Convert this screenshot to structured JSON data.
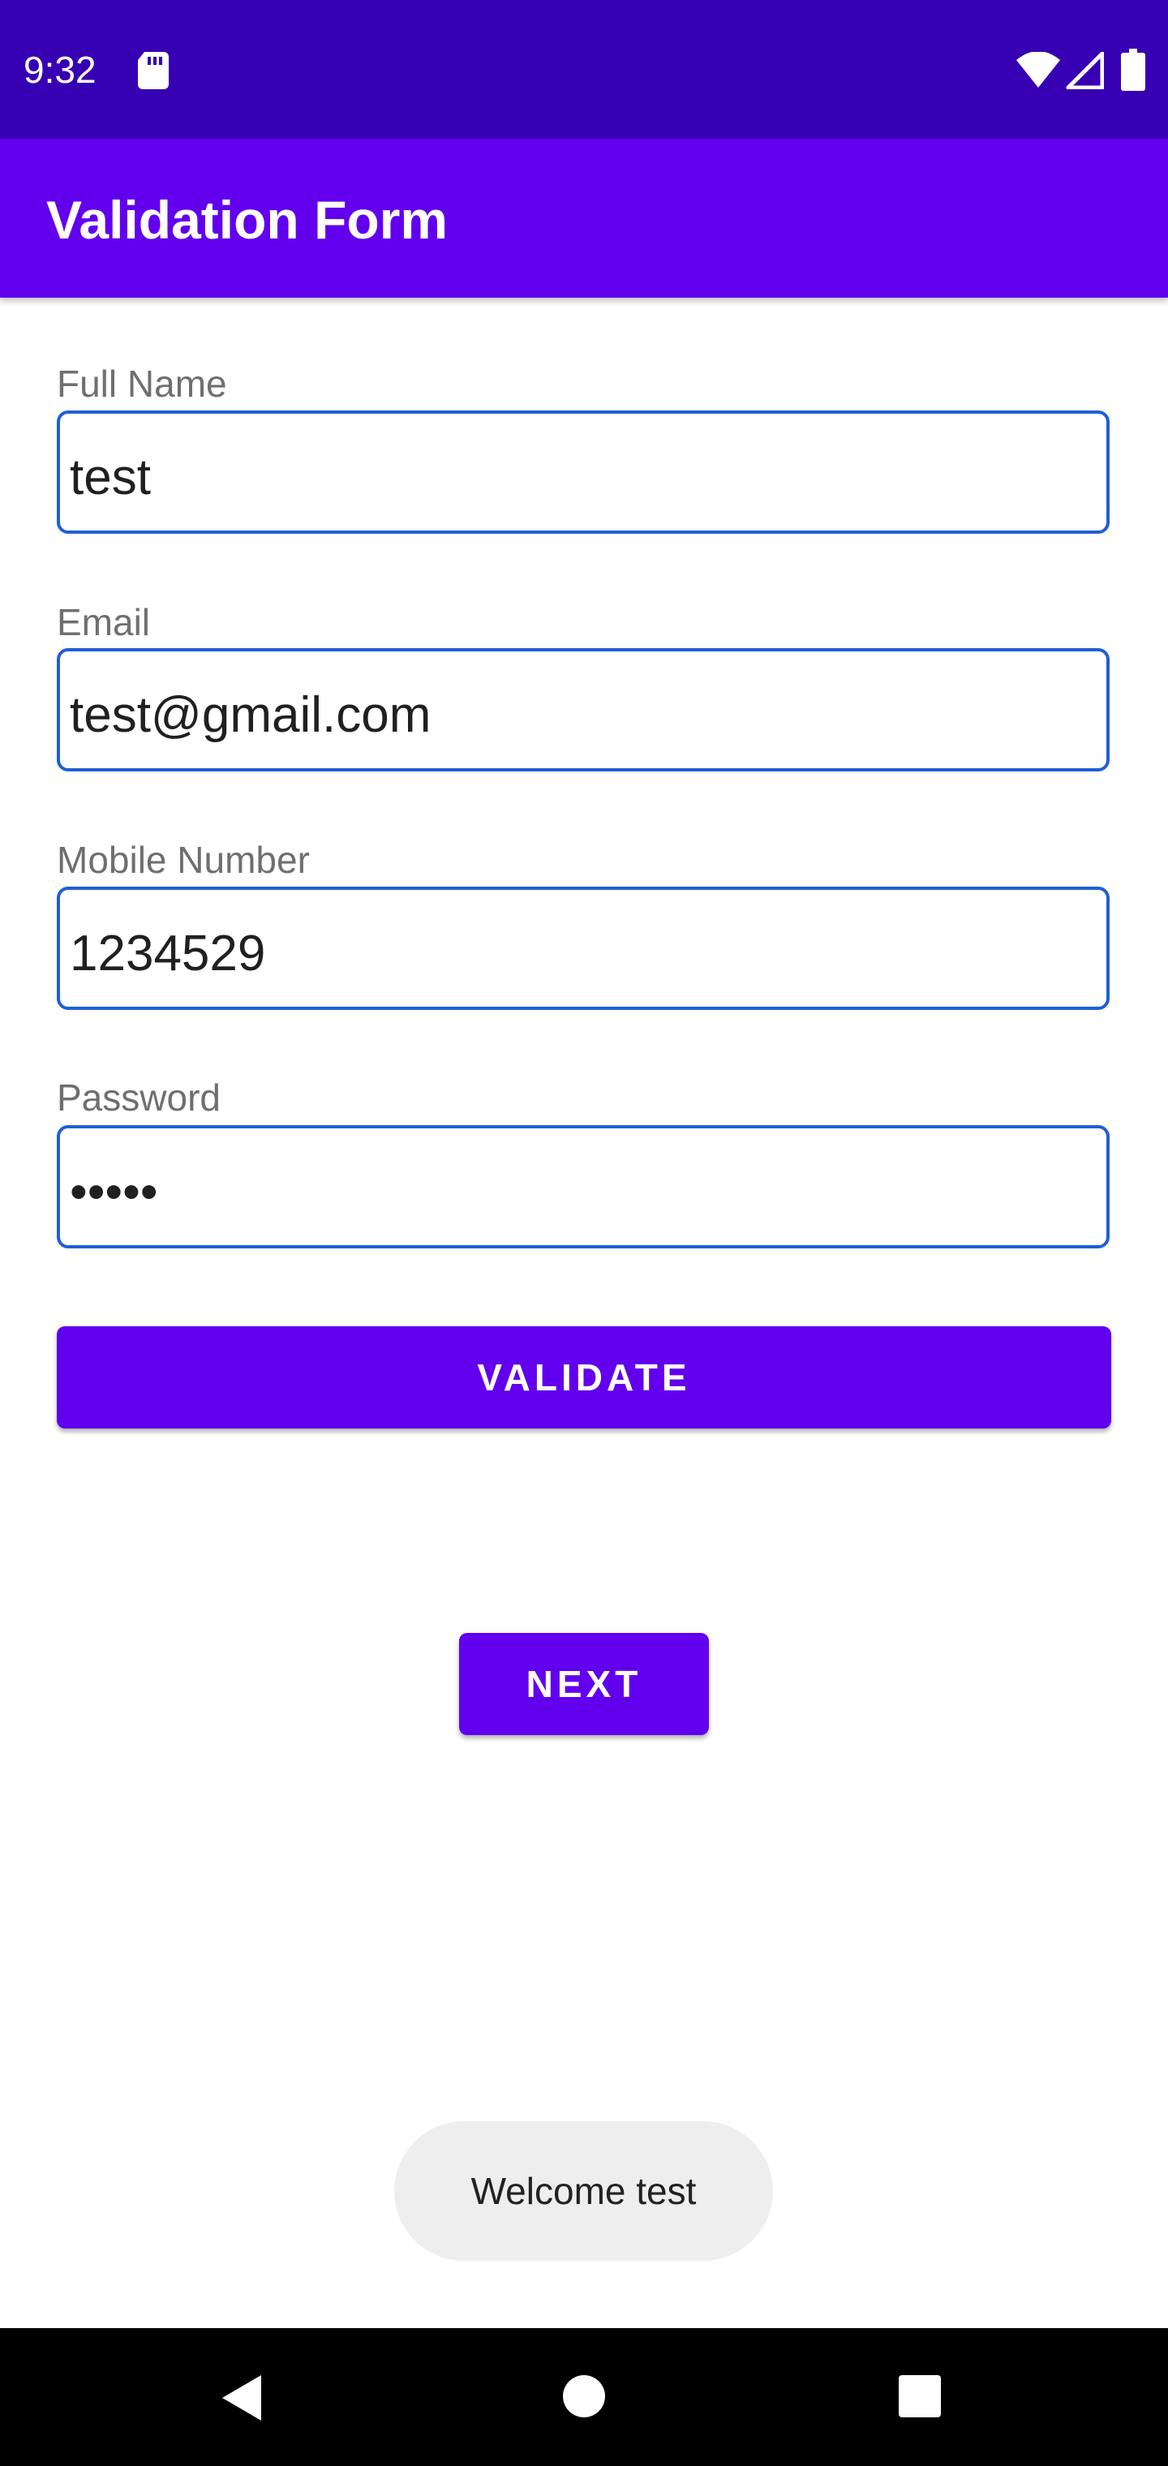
{
  "status_bar": {
    "time": "9:32",
    "icons": [
      "sd-card-icon",
      "wifi-icon",
      "signal-icon",
      "battery-icon"
    ]
  },
  "app_bar": {
    "title": "Validation Form"
  },
  "form": {
    "full_name": {
      "label": "Full Name",
      "value": "test"
    },
    "email": {
      "label": "Email",
      "value": "test@gmail.com"
    },
    "mobile": {
      "label": "Mobile Number",
      "value": "1234529"
    },
    "password": {
      "label": "Password",
      "value": "•••••"
    }
  },
  "buttons": {
    "validate_label": "VALIDATE",
    "next_label": "NEXT"
  },
  "toast": {
    "message": "Welcome test"
  },
  "nav_bar": {
    "icons": [
      "back-icon",
      "home-icon",
      "recents-icon"
    ]
  },
  "colors": {
    "status_bar": "#3700b3",
    "primary": "#6200ee",
    "field_border": "#1e5fd9"
  }
}
